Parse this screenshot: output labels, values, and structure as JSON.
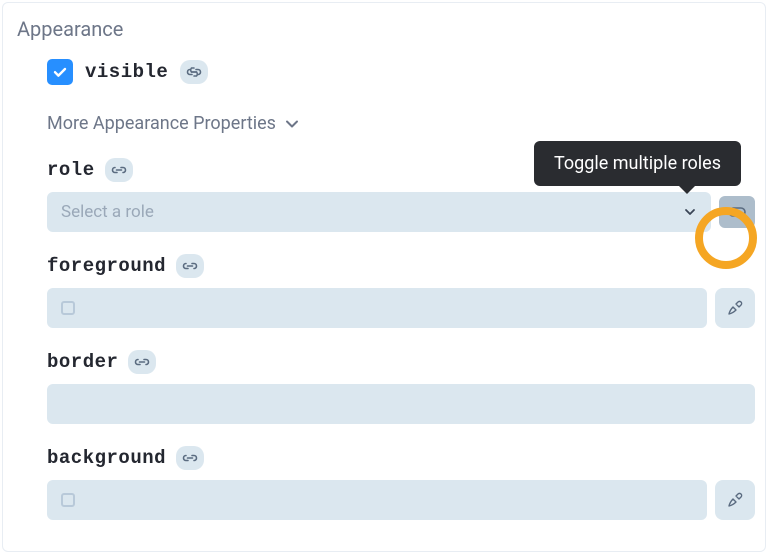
{
  "section": {
    "title": "Appearance"
  },
  "visible": {
    "label": "visible",
    "checked": true
  },
  "more": {
    "label": "More Appearance Properties"
  },
  "tooltip": {
    "text": "Toggle multiple roles"
  },
  "props": {
    "role": {
      "label": "role",
      "placeholder": "Select a role"
    },
    "foreground": {
      "label": "foreground"
    },
    "border": {
      "label": "border"
    },
    "background": {
      "label": "background"
    }
  }
}
